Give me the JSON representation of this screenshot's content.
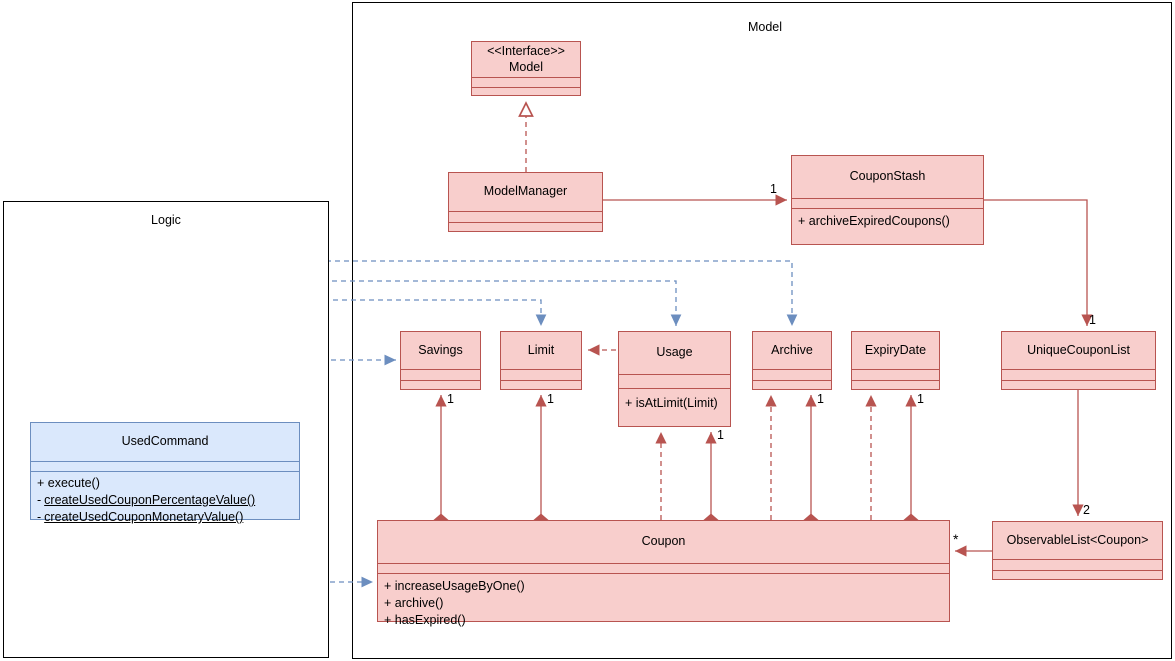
{
  "diagram": {
    "type": "uml-class-diagram",
    "colors": {
      "class_fill": "#f8cecc",
      "class_stroke": "#b85450",
      "logic_fill": "#dae8fc",
      "logic_stroke": "#6c8ebf",
      "package_stroke": "#000000",
      "text": "#000000"
    }
  },
  "packages": {
    "model": {
      "label": "Model"
    },
    "logic": {
      "label": "Logic"
    }
  },
  "classes": {
    "model_interface": {
      "stereotype": "<<Interface>>",
      "name": "Model",
      "members": []
    },
    "model_manager": {
      "name": "ModelManager",
      "members": []
    },
    "coupon_stash": {
      "name": "CouponStash",
      "members": [
        "+ archiveExpiredCoupons()"
      ]
    },
    "savings": {
      "name": "Savings",
      "members": []
    },
    "limit": {
      "name": "Limit",
      "members": []
    },
    "usage": {
      "name": "Usage",
      "members": [
        "+ isAtLimit(Limit)"
      ]
    },
    "archive": {
      "name": "Archive",
      "members": []
    },
    "expiry_date": {
      "name": "ExpiryDate",
      "members": []
    },
    "unique_coupon_list": {
      "name": "UniqueCouponList",
      "members": []
    },
    "observable_list": {
      "name": "ObservableList<Coupon>",
      "members": []
    },
    "coupon": {
      "name": "Coupon",
      "members": [
        "+ increaseUsageByOne()",
        "+ archive()",
        "+ hasExpired()"
      ]
    },
    "used_command": {
      "name": "UsedCommand",
      "members": [
        "+ execute()",
        "- createUsedCouponPercentageValue()",
        "- createUsedCouponMonetaryValue()"
      ],
      "members_underlined": [
        false,
        true,
        true
      ]
    }
  },
  "multiplicities": {
    "manager_to_stash": "1",
    "stash_to_uniquelist": "1",
    "uniquelist_to_observablelist": "2",
    "coupon_to_observablelist": "*",
    "savings_to_coupon": "1",
    "limit_to_coupon": "1",
    "usage_to_coupon": "1",
    "archive_to_coupon": "1",
    "expiry_to_coupon": "1",
    "usage_inner": "1"
  }
}
